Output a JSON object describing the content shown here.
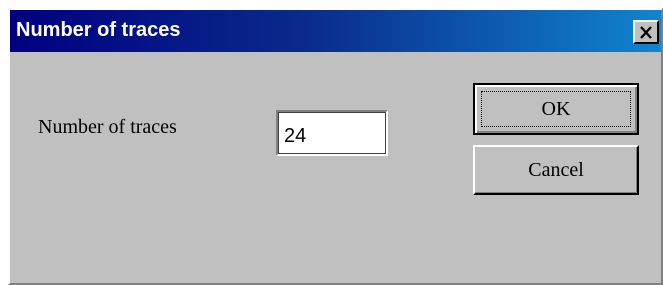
{
  "window": {
    "title": "Number of traces",
    "close_icon": "close-icon"
  },
  "form": {
    "label": "Number of traces",
    "value": "24"
  },
  "buttons": {
    "ok_label": "OK",
    "cancel_label": "Cancel"
  },
  "colors": {
    "titlebar_start": "#000080",
    "titlebar_end": "#1084d0",
    "dialog_face": "#c0c0c0"
  }
}
